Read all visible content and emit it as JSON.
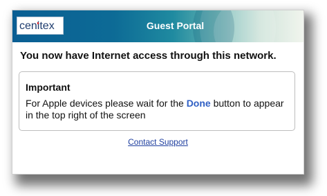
{
  "header": {
    "logo_text": "cenitex",
    "title": "Guest Portal"
  },
  "main": {
    "headline": "You now have Internet access through this network.",
    "notice": {
      "title": "Important",
      "body_before": "For Apple devices please wait for the ",
      "body_highlight": "Done",
      "body_after": " button to appear in the top right of the screen"
    },
    "support_link": "Contact Support"
  },
  "colors": {
    "header_start": "#0a5e93",
    "header_end": "#eef3ea",
    "logo_accent": "#d21f2b",
    "link": "#1f3f9f",
    "done_highlight": "#2f5fc4"
  }
}
